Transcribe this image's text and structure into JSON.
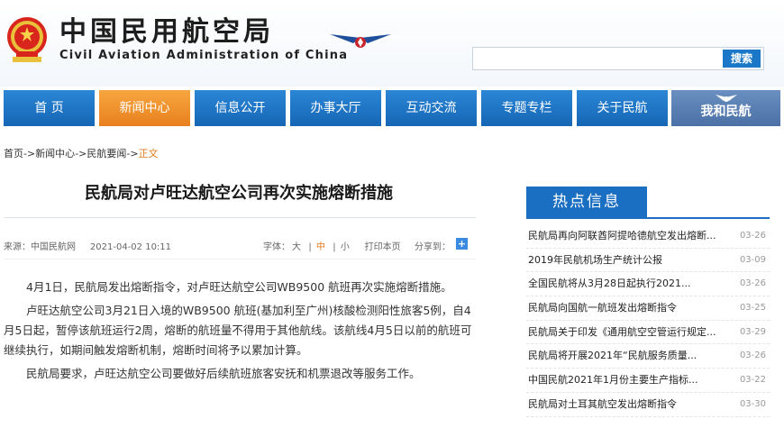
{
  "header": {
    "title_cn": "中国民用航空局",
    "title_en": "Civil Aviation Administration of China",
    "search": {
      "placeholder": "",
      "button": "搜索"
    }
  },
  "nav": {
    "items": [
      {
        "label": "首 页"
      },
      {
        "label": "新闻中心"
      },
      {
        "label": "信息公开"
      },
      {
        "label": "办事大厅"
      },
      {
        "label": "互动交流"
      },
      {
        "label": "专题专栏"
      },
      {
        "label": "关于民航"
      },
      {
        "label": "我和民航"
      }
    ]
  },
  "breadcrumb": {
    "items": [
      "首页",
      "新闻中心",
      "民航要闻"
    ],
    "separator": "->",
    "current": "正文"
  },
  "article": {
    "title": "民航局对卢旺达航空公司再次实施熔断措施",
    "source": "来源：中国民航网",
    "date": "2021-04-02 10:11",
    "font_size_label": "字体：",
    "font_large": "大",
    "font_medium": "中",
    "font_small": "小",
    "print": "打印本页",
    "share": "分享到：",
    "paragraphs": [
      "4月1日，民航局发出熔断指令，对卢旺达航空公司WB9500 航班再次实施熔断措施。",
      "卢旺达航空公司3月21日入境的WB9500 航班(基加利至广州)核酸检测阳性旅客5例，自4月5日起，暂停该航班运行2周，熔断的航班量不得用于其他航线。该航线4月5日以前的航班可继续执行，如期间触发熔断机制，熔断时间将予以累加计算。",
      "民航局要求，卢旺达航空公司要做好后续航班旅客安抚和机票退改等服务工作。"
    ]
  },
  "sidebar": {
    "heading": "热点信息",
    "items": [
      {
        "title": "民航局再向阿联酋阿提哈德航空发出熔断...",
        "date": "03-26"
      },
      {
        "title": "2019年民航机场生产统计公报",
        "date": "03-09"
      },
      {
        "title": "全国民航将从3月28日起执行2021...",
        "date": "03-26"
      },
      {
        "title": "民航局向国航一航班发出熔断指令",
        "date": "03-25"
      },
      {
        "title": "民航局关于印发《通用航空空管运行规定...",
        "date": "03-29"
      },
      {
        "title": "民航局将开展2021年“民航服务质量...",
        "date": "03-26"
      },
      {
        "title": "中国民航2021年1月份主要生产指标...",
        "date": "03-22"
      },
      {
        "title": "民航局对土耳其航空发出熔断指令",
        "date": "03-30"
      }
    ]
  },
  "colors": {
    "nav_blue": "#1b6fc2",
    "nav_active": "#e8801d",
    "accent_orange": "#e07a1b"
  }
}
